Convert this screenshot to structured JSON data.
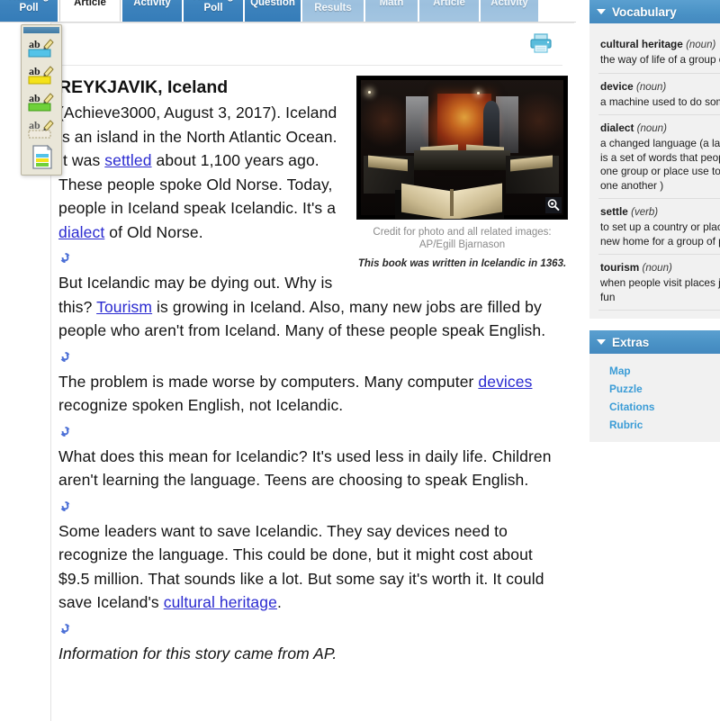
{
  "tabs": [
    {
      "label": "Reading\nPoll",
      "state": "normal"
    },
    {
      "label": "Article",
      "state": "active"
    },
    {
      "label": "Activity",
      "state": "normal"
    },
    {
      "label": "Reading\nPoll",
      "state": "normal"
    },
    {
      "label": "Question",
      "state": "normal"
    },
    {
      "label": "Poll Results",
      "state": "dim"
    },
    {
      "label": "Math",
      "state": "dim"
    },
    {
      "label": "Article",
      "state": "dim"
    },
    {
      "label": "Activity",
      "state": "dim"
    }
  ],
  "toolbar": {
    "print_label": "print-icon",
    "palette_tools": [
      {
        "name": "highlighter-blue",
        "color": "#53c3e8"
      },
      {
        "name": "highlighter-yellow",
        "color": "#f4e21a"
      },
      {
        "name": "highlighter-green",
        "color": "#6fd13a"
      },
      {
        "name": "highlighter-clear",
        "color": "#ffffff"
      },
      {
        "name": "notes-page",
        "color": "#ffffff"
      }
    ]
  },
  "article": {
    "headline": "REYKJAVIK, Iceland",
    "paragraphs": [
      {
        "segments": [
          {
            "t": "(Achieve3000, August 3, 2017). Iceland is an island in the North Atlantic Ocean. It was ",
            "link": false
          },
          {
            "t": "settled",
            "link": true
          },
          {
            "t": " about 1,100 years ago. These people spoke Old Norse. Today, people in Iceland speak Icelandic. It's a ",
            "link": false
          },
          {
            "t": "dialect",
            "link": true
          },
          {
            "t": " of Old Norse.",
            "link": false
          }
        ]
      },
      {
        "segments": [
          {
            "t": "But Icelandic may be dying out. Why is this? ",
            "link": false
          },
          {
            "t": "Tourism",
            "link": true
          },
          {
            "t": " is growing in Iceland. Also, many new jobs are filled by people who aren't from Iceland. Many of these people speak English.",
            "link": false
          }
        ]
      },
      {
        "segments": [
          {
            "t": "The problem is made worse by computers. Many computer ",
            "link": false
          },
          {
            "t": "devices",
            "link": true
          },
          {
            "t": " recognize spoken English, not Icelandic.",
            "link": false
          }
        ]
      },
      {
        "segments": [
          {
            "t": "What does this mean for Icelandic? It's used less in daily life. Children aren't learning the language. Teens are choosing to speak English.",
            "link": false
          }
        ]
      },
      {
        "segments": [
          {
            "t": "Some leaders want to save Icelandic. They say devices need to recognize the language. This could be done, but it might cost about $9.5 million. That sounds like a lot. But some say it's worth it. It could save Iceland's ",
            "link": false
          },
          {
            "t": "cultural heritage",
            "link": true
          },
          {
            "t": ".",
            "link": false
          }
        ]
      }
    ],
    "source_note": "Information for this story came from AP."
  },
  "photo": {
    "credit": "Credit for photo and all related images: AP/Egill Bjarnason",
    "caption": "This book was written in Icelandic in 1363.",
    "zoom_icon": "magnifier-icon"
  },
  "sidebar": {
    "vocabulary": {
      "title": "Vocabulary",
      "items": [
        {
          "term": "cultural heritage",
          "pos": "(noun)",
          "definition": [
            "the way of life of a group o"
          ]
        },
        {
          "term": "device",
          "pos": "(noun)",
          "definition": [
            "a machine used to do som"
          ]
        },
        {
          "term": "dialect",
          "pos": "(noun)",
          "definition": [
            "a changed language (a lan",
            "is a set of words that peop",
            "one group or place use to",
            "one another )"
          ]
        },
        {
          "term": "settle",
          "pos": "(verb)",
          "definition": [
            "to set up a country or plac",
            "new home for a group of p"
          ]
        },
        {
          "term": "tourism",
          "pos": "(noun)",
          "definition": [
            "when people visit places ju",
            "fun"
          ]
        }
      ]
    },
    "extras": {
      "title": "Extras",
      "links": [
        "Map",
        "Puzzle",
        "Citations",
        "Rubric"
      ]
    }
  },
  "colors": {
    "tab_active_bg": "#ffffff",
    "tab_bg": "#3d83bd",
    "panel_header": "#4a92c6",
    "link": "#2a2ad0",
    "extras_link": "#3b9cd6"
  }
}
